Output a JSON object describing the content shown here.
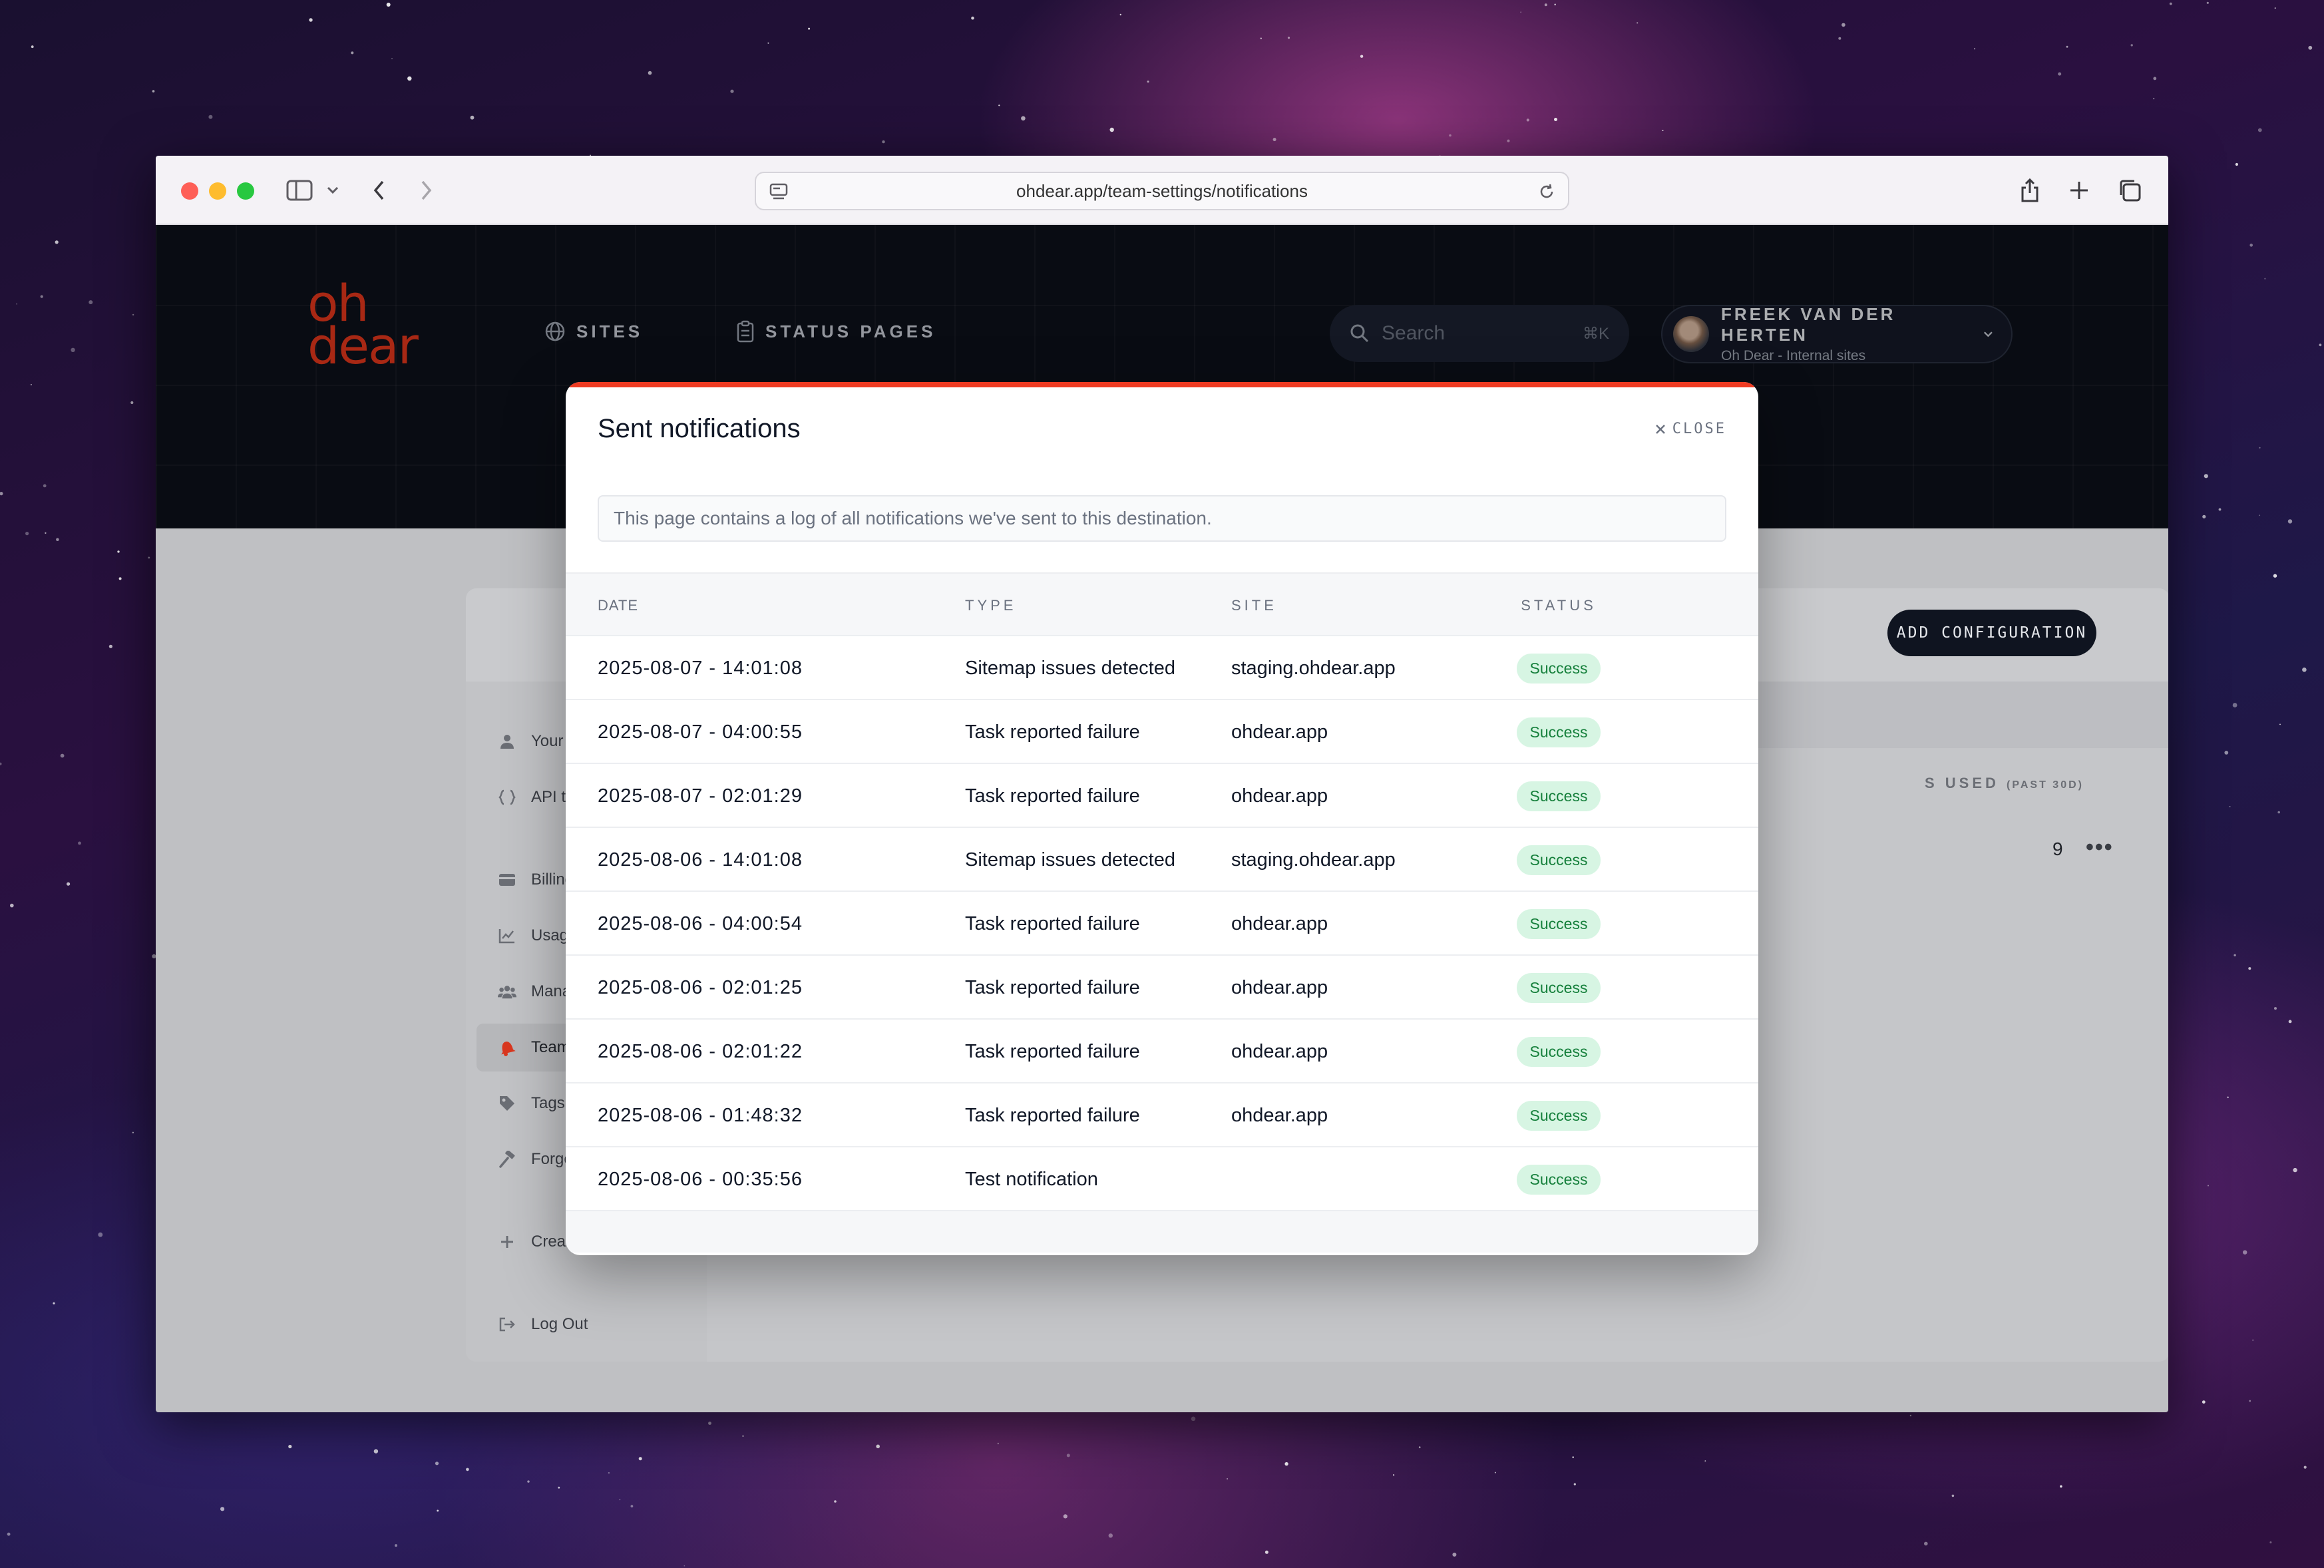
{
  "browser": {
    "url": "ohdear.app/team-settings/notifications"
  },
  "app": {
    "logo_line1": "oh",
    "logo_line2": "dear",
    "nav": [
      {
        "label": "SITES",
        "icon": "globe-icon"
      },
      {
        "label": "STATUS PAGES",
        "icon": "clipboard-icon"
      }
    ],
    "search": {
      "placeholder": "Search",
      "shortcut": "⌘K"
    },
    "user": {
      "name": "FREEK VAN DER HERTEN",
      "team": "Oh Dear - Internal sites"
    },
    "add_configuration_label": "ADD CONFIGURATION",
    "used_column": {
      "label": "S USED",
      "suffix": "(PAST 30D)",
      "value": "9"
    },
    "sidebar": [
      {
        "label": "Your profile",
        "icon": "user-icon"
      },
      {
        "label": "API tokens",
        "icon": "braces-icon"
      },
      {
        "label": "Billing",
        "icon": "credit-card-icon"
      },
      {
        "label": "Usage",
        "icon": "chart-icon"
      },
      {
        "label": "Manage team",
        "icon": "team-icon"
      },
      {
        "label": "Team notifications",
        "icon": "bell-icon",
        "active": true
      },
      {
        "label": "Tags",
        "icon": "tag-icon"
      },
      {
        "label": "Forge import",
        "icon": "hammer-icon"
      },
      {
        "label": "Create new team",
        "icon": "plus-icon"
      },
      {
        "label": "Log Out",
        "icon": "logout-icon"
      }
    ]
  },
  "modal": {
    "title": "Sent notifications",
    "close_label": "CLOSE",
    "info": "This page contains a log of all notifications we've sent to this destination.",
    "columns": {
      "date": "DATE",
      "type": "TYPE",
      "site": "SITE",
      "status": "STATUS"
    },
    "rows": [
      {
        "date": "2025-08-07 - 14:01:08",
        "type": "Sitemap issues detected",
        "site": "staging.ohdear.app",
        "status": "Success"
      },
      {
        "date": "2025-08-07 - 04:00:55",
        "type": "Task reported failure",
        "site": "ohdear.app",
        "status": "Success"
      },
      {
        "date": "2025-08-07 - 02:01:29",
        "type": "Task reported failure",
        "site": "ohdear.app",
        "status": "Success"
      },
      {
        "date": "2025-08-06 - 14:01:08",
        "type": "Sitemap issues detected",
        "site": "staging.ohdear.app",
        "status": "Success"
      },
      {
        "date": "2025-08-06 - 04:00:54",
        "type": "Task reported failure",
        "site": "ohdear.app",
        "status": "Success"
      },
      {
        "date": "2025-08-06 - 02:01:25",
        "type": "Task reported failure",
        "site": "ohdear.app",
        "status": "Success"
      },
      {
        "date": "2025-08-06 - 02:01:22",
        "type": "Task reported failure",
        "site": "ohdear.app",
        "status": "Success"
      },
      {
        "date": "2025-08-06 - 01:48:32",
        "type": "Task reported failure",
        "site": "ohdear.app",
        "status": "Success"
      },
      {
        "date": "2025-08-06 - 00:35:56",
        "type": "Test notification",
        "site": "",
        "status": "Success"
      }
    ]
  },
  "colors": {
    "brand": "#ef3b22",
    "success_bg": "#d7f5e3",
    "success_text": "#16803c",
    "header_bg": "#0d111a"
  }
}
